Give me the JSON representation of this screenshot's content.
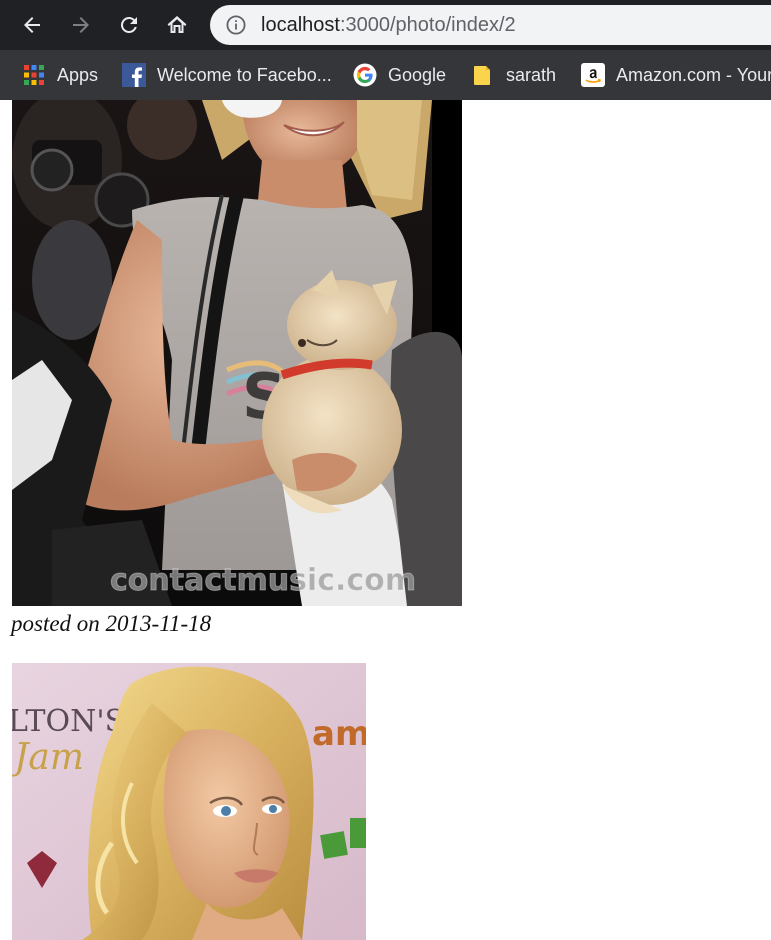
{
  "browser": {
    "url_host": "localhost",
    "url_path": ":3000/photo/index/2",
    "icons": {
      "back": "arrow-left-icon",
      "forward": "arrow-right-icon",
      "reload": "reload-icon",
      "home": "home-icon",
      "site_info": "info-icon"
    },
    "bookmarks": [
      {
        "label": "Apps",
        "icon": "apps-grid-icon"
      },
      {
        "label": "Welcome to Facebo...",
        "icon": "facebook-icon"
      },
      {
        "label": "Google",
        "icon": "google-icon"
      },
      {
        "label": "sarath",
        "icon": "folder-icon"
      },
      {
        "label": "Amazon.com - Your",
        "icon": "amazon-icon"
      }
    ]
  },
  "posts": [
    {
      "photo_icon": "photo-woman-with-puppy",
      "watermark": "contactmusic.com",
      "caption": "posted on 2013-11-18"
    },
    {
      "photo_icon": "photo-blonde-woman-portrait",
      "backdrop_text_1": "LTON'S",
      "backdrop_text_2": "Jam",
      "backdrop_text_3": "ame"
    }
  ],
  "colors": {
    "toolbar_bg": "#202124",
    "bookmarks_bg": "#35363a",
    "omnibox_bg": "#f1f3f4"
  }
}
